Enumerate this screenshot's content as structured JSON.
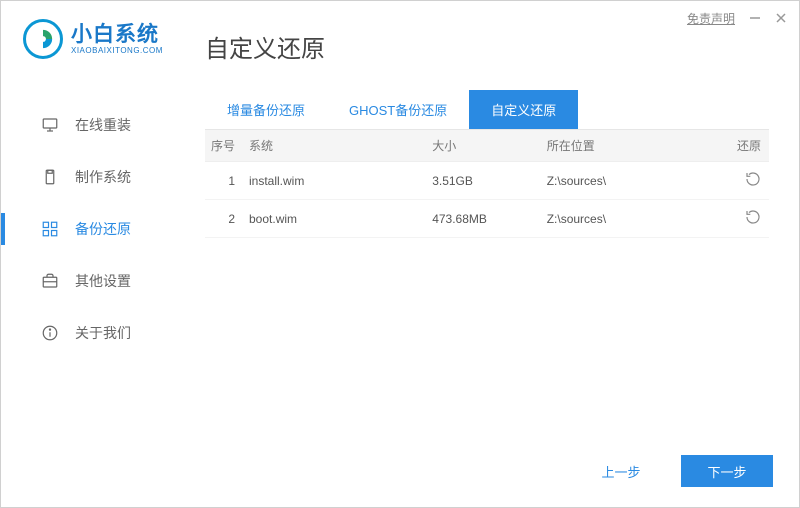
{
  "window": {
    "disclaimer": "免责声明"
  },
  "brand": {
    "name": "小白系统",
    "sub": "XIAOBAIXITONG.COM"
  },
  "sidebar": {
    "items": [
      {
        "label": "在线重装"
      },
      {
        "label": "制作系统"
      },
      {
        "label": "备份还原"
      },
      {
        "label": "其他设置"
      },
      {
        "label": "关于我们"
      }
    ]
  },
  "page": {
    "title": "自定义还原"
  },
  "tabs": [
    {
      "label": "增量备份还原"
    },
    {
      "label": "GHOST备份还原"
    },
    {
      "label": "自定义还原"
    }
  ],
  "table": {
    "headers": {
      "idx": "序号",
      "sys": "系统",
      "size": "大小",
      "loc": "所在位置",
      "act": "还原"
    },
    "rows": [
      {
        "idx": "1",
        "sys": "install.wim",
        "size": "3.51GB",
        "loc": "Z:\\sources\\"
      },
      {
        "idx": "2",
        "sys": "boot.wim",
        "size": "473.68MB",
        "loc": "Z:\\sources\\"
      }
    ]
  },
  "footer": {
    "prev": "上一步",
    "next": "下一步"
  }
}
